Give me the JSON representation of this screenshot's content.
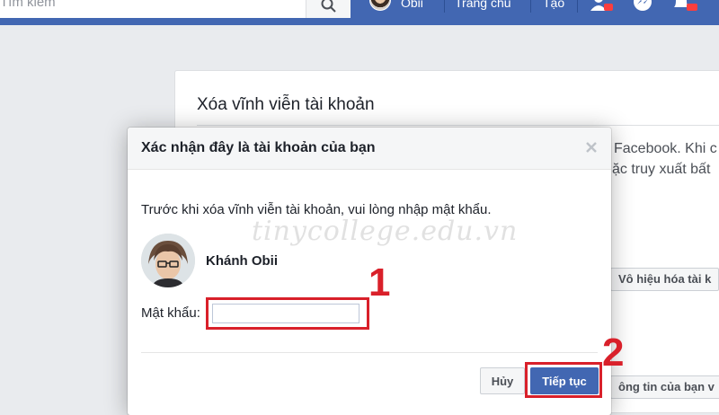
{
  "topbar": {
    "search_placeholder": "Tìm kiếm",
    "user_name": "Obii",
    "home_label": "Trang chủ",
    "create_label": "Tạo"
  },
  "page": {
    "card_title": "Xóa vĩnh viễn tài khoản",
    "card_text_1": "Facebook. Khi c",
    "card_text_2": "ặc truy xuất bất",
    "deactivate_button": "Vô hiệu hóa tài k",
    "download_button": "ông tin của bạn v"
  },
  "modal": {
    "title": "Xác nhận đây là tài khoản của bạn",
    "close_glyph": "×",
    "instruction": "Trước khi xóa vĩnh viễn tài khoản, vui lòng nhập mật khẩu.",
    "profile_name": "Khánh Obii",
    "password_label": "Mật khẩu:",
    "password_value": "",
    "cancel_label": "Hủy",
    "continue_label": "Tiếp tục"
  },
  "annotations": {
    "step1": "1",
    "step2": "2",
    "highlight_color": "#d9202a"
  },
  "watermark": "tinycollege.edu.vn",
  "colors": {
    "brand_blue": "#4267b2",
    "page_bg": "#e9ebee"
  }
}
